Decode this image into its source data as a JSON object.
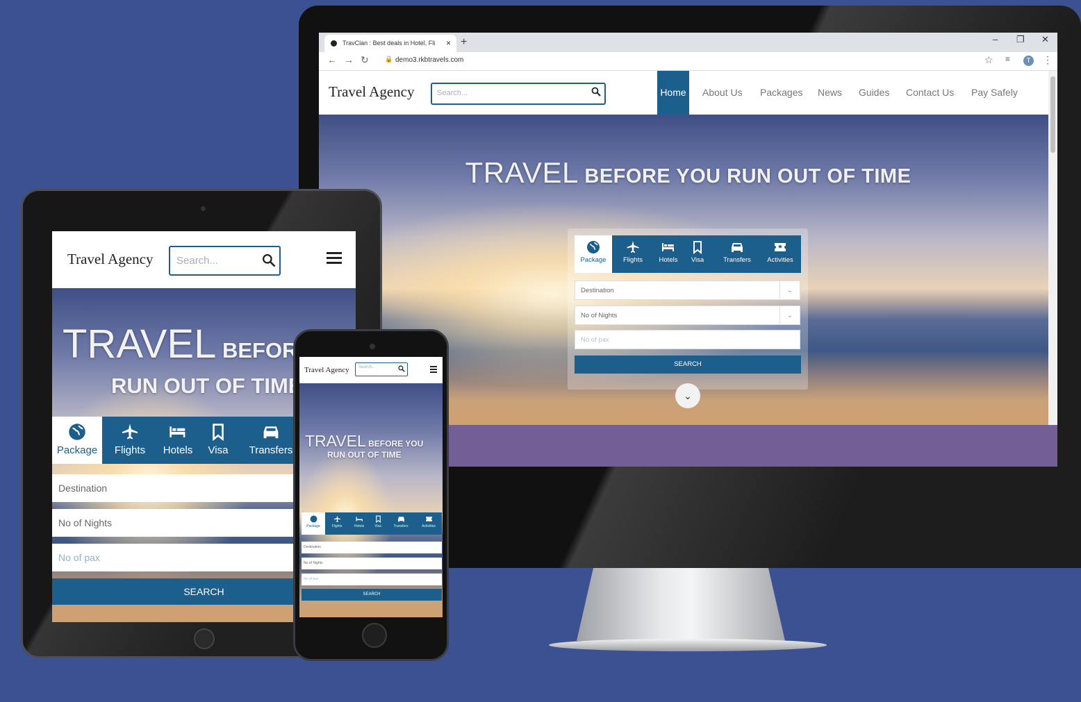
{
  "colors": {
    "background": "#3b5191",
    "accent": "#1c5e8c",
    "footer_band": "#735f95"
  },
  "browser": {
    "tab_title": "TravClan : Best deals in Hotel, Fli",
    "url": "demo3.rkbtravels.com",
    "avatar_initial": "T"
  },
  "site": {
    "logo": "Travel Agency",
    "search_placeholder": "Search...",
    "nav": [
      "Home",
      "About Us",
      "Packages",
      "News",
      "Guides",
      "Contact Us",
      "Pay Safely"
    ],
    "hero_big": "TRAVEL",
    "hero_rest": "BEFORE YOU RUN OUT OF TIME",
    "tablet_hero_line1_small": "BEFORE",
    "tablet_hero_line2": "RUN OUT OF TIME",
    "phone_hero_line1_small": "BEFORE YOU",
    "phone_hero_line2": "RUN OUT OF TIME",
    "tabs": [
      {
        "label": "Package",
        "icon": "globe-icon"
      },
      {
        "label": "Flights",
        "icon": "plane-icon"
      },
      {
        "label": "Hotels",
        "icon": "bed-icon"
      },
      {
        "label": "Visa",
        "icon": "bookmark-icon"
      },
      {
        "label": "Transfers",
        "icon": "car-icon"
      },
      {
        "label": "Activities",
        "icon": "ticket-icon"
      }
    ],
    "fields": {
      "destination": "Destination",
      "nights": "No of Nights",
      "pax": "No of pax"
    },
    "search_button": "SEARCH"
  }
}
